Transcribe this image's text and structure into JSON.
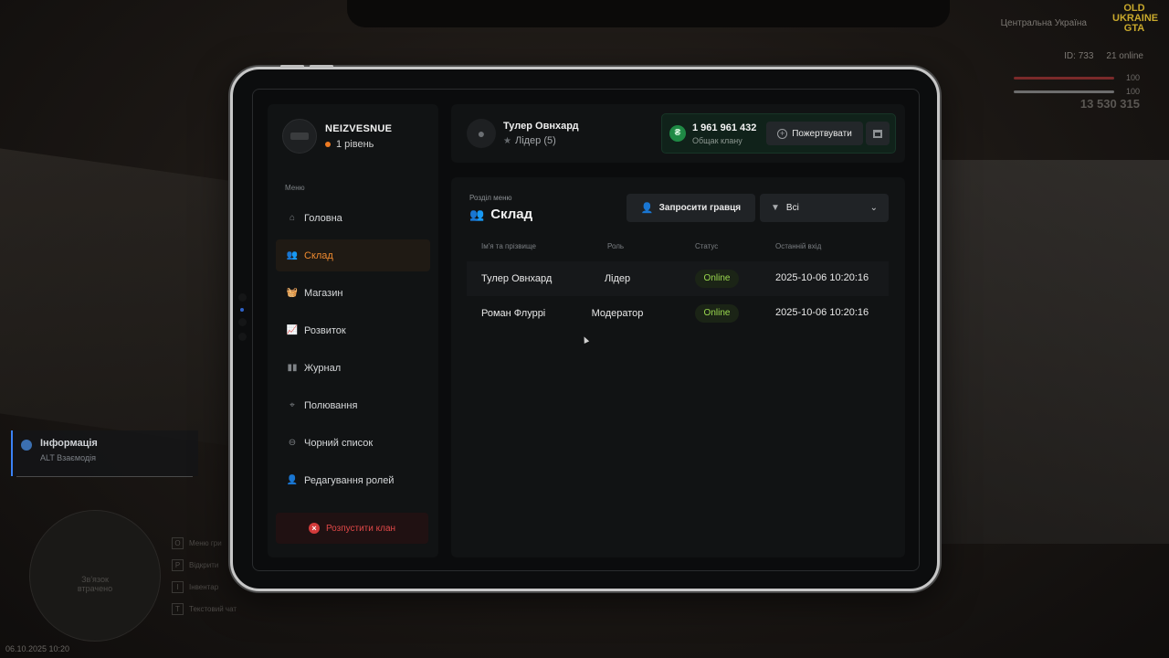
{
  "hud": {
    "region": "Центральна Україна",
    "logo_top": "OLD",
    "logo_mid": "UKRAINE",
    "logo_bottom": "GTA",
    "player_id": "ID: 733",
    "online": "21 online",
    "health": "100",
    "armor": "100",
    "money": "13 530 315",
    "info_title": "Інформація",
    "info_sub": "ALT Взаємодія",
    "minimap_text_1": "Зв'язок",
    "minimap_text_2": "втрачено",
    "keys": [
      {
        "key": "O",
        "label": "Меню гри"
      },
      {
        "key": "P",
        "label": "Відкрити"
      },
      {
        "key": "I",
        "label": "Інвентар"
      },
      {
        "key": "T",
        "label": "Текстовий чат"
      }
    ],
    "date": "06.10.2025 10:20"
  },
  "profile": {
    "name": "NEIZVESNUE",
    "level": "1 рівень"
  },
  "menu": {
    "title": "Меню",
    "items": [
      {
        "label": "Головна",
        "icon": "home-icon"
      },
      {
        "label": "Склад",
        "icon": "people-icon",
        "active": true
      },
      {
        "label": "Магазин",
        "icon": "basket-icon"
      },
      {
        "label": "Розвиток",
        "icon": "chart-icon"
      },
      {
        "label": "Журнал",
        "icon": "book-icon"
      },
      {
        "label": "Полювання",
        "icon": "crosshair-icon"
      },
      {
        "label": "Чорний список",
        "icon": "block-icon"
      },
      {
        "label": "Редагування ролей",
        "icon": "user-edit-icon"
      }
    ],
    "disband": "Розпустити клан"
  },
  "topbar": {
    "user_name": "Тулер Овнхард",
    "user_role": "Лідер (5)",
    "bank_sum": "1 961 961 432",
    "bank_label": "Общак клану",
    "donate": "Пожертвувати"
  },
  "section": {
    "subtitle": "Розділ меню",
    "title": "Склад",
    "invite": "Запросити гравця",
    "filter": "Всі"
  },
  "table": {
    "headers": [
      "Ім'я та прізвище",
      "Роль",
      "Статус",
      "Останній вхід"
    ],
    "rows": [
      [
        "Тулер Овнхард",
        "Лідер",
        "Online",
        "2025-10-06 10:20:16"
      ],
      [
        "Роман Флуррі",
        "Модератор",
        "Online",
        "2025-10-06 10:20:16"
      ]
    ]
  },
  "colors": {
    "accent": "#ef8a2f",
    "online": "#9bd94f",
    "danger": "#e04848",
    "bank_green": "#1f8a45"
  }
}
